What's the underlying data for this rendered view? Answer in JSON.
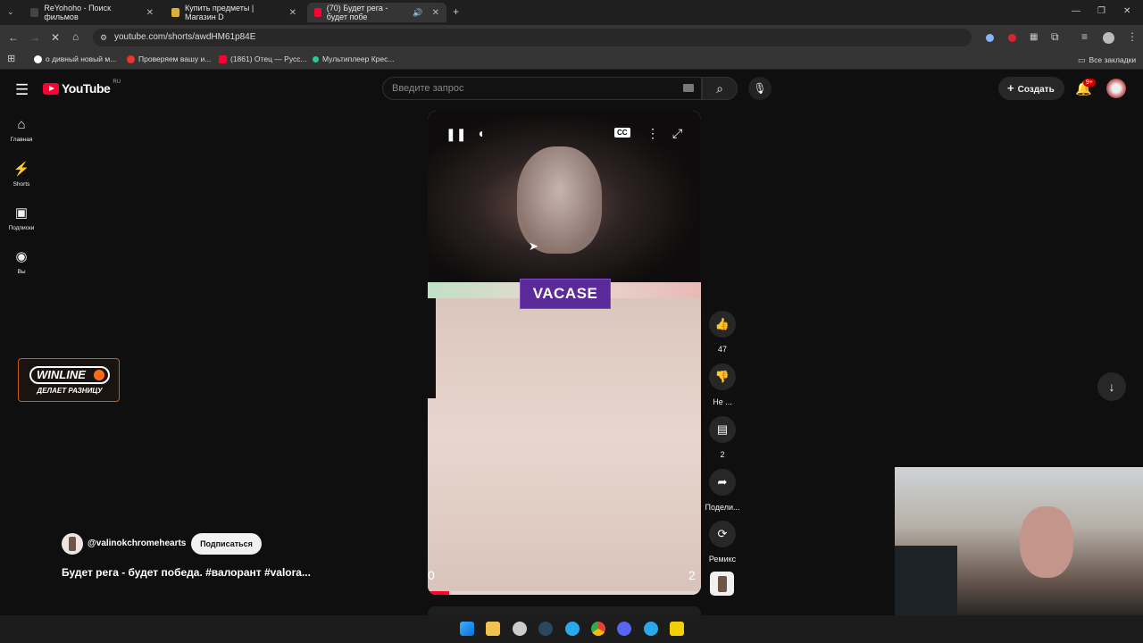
{
  "browser": {
    "tabs": [
      {
        "title": "ReYohoho - Поиск фильмов"
      },
      {
        "title": "Купить предметы | Магазин D"
      },
      {
        "title": "(70) Будет рега - будет побе"
      }
    ],
    "url": "youtube.com/shorts/awdHM61p84E",
    "bookmarks": [
      {
        "label": "о дивный новый м..."
      },
      {
        "label": "Проверяем вашу и..."
      },
      {
        "label": "(1861) Отец — Русс..."
      },
      {
        "label": "Мультиплеер Крес..."
      }
    ],
    "all_bookmarks": "Все закладки"
  },
  "youtube": {
    "logo": "YouTube",
    "region": "RU",
    "search_placeholder": "Введите запрос",
    "create_label": "Создать",
    "notif_count": "9+",
    "sidebar": [
      {
        "label": "Главная",
        "icon": "home-icon"
      },
      {
        "label": "Shorts",
        "icon": "shorts-icon"
      },
      {
        "label": "Подписки",
        "icon": "subscriptions-icon"
      },
      {
        "label": "Вы",
        "icon": "you-icon"
      }
    ]
  },
  "video": {
    "overlay_text": "VACASE",
    "progress": 0.08,
    "hud_left": "0",
    "hud_right": "2"
  },
  "actions": {
    "like_count": "47",
    "dislike_label": "Не ...",
    "comment_count": "2",
    "share_label": "Подели...",
    "remix_label": "Ремикс"
  },
  "ad": {
    "brand": "WINLINE",
    "tagline": "ДЕЛАЕТ РАЗНИЦУ"
  },
  "channel": {
    "handle": "@valinokchromehearts",
    "subscribe_label": "Подписаться",
    "title": "Будет рега - будет победа. #валорант #valora..."
  }
}
